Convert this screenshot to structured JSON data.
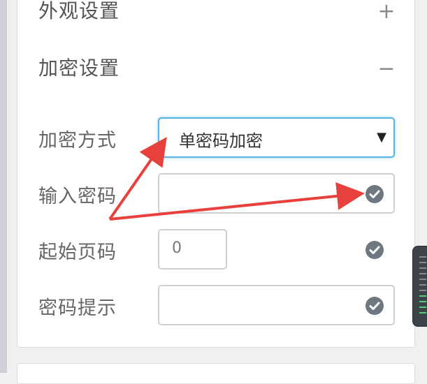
{
  "sections": {
    "appearance": {
      "title": "外观设置",
      "toggle": "+"
    },
    "encryption": {
      "title": "加密设置",
      "toggle": "−"
    }
  },
  "form": {
    "encryption_method": {
      "label": "加密方式",
      "value": "单密码加密"
    },
    "password": {
      "label": "输入密码",
      "value": ""
    },
    "start_page": {
      "label": "起始页码",
      "value": "0"
    },
    "password_hint": {
      "label": "密码提示",
      "value": ""
    }
  },
  "icons": {
    "check": "check-circle-icon",
    "caret": "caret-down-icon"
  },
  "colors": {
    "arrow": "#e8413d",
    "focus_border": "#57b3e3",
    "check_icon": "#6f7780"
  }
}
